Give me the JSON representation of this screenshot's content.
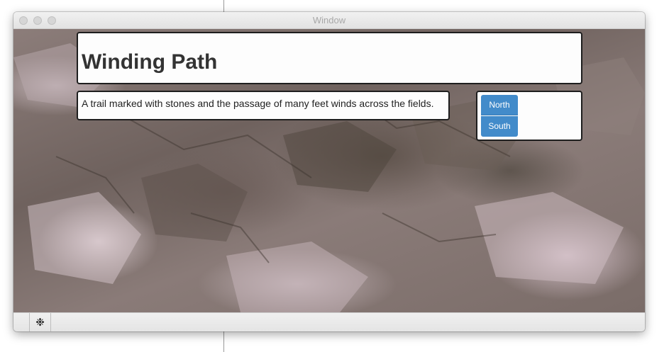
{
  "window": {
    "title": "Window"
  },
  "header": {
    "title": "Winding Path"
  },
  "main": {
    "description": "A trail marked with stones and the passage of many feet winds across the fields."
  },
  "navigation": {
    "buttons": [
      {
        "label": "North"
      },
      {
        "label": "South"
      }
    ]
  },
  "toolbar": {
    "settings_icon": "gear-icon"
  },
  "colors": {
    "button_accent": "#428bca",
    "panel_border": "#1e1e1e",
    "panel_background": "#fdfdfd"
  }
}
